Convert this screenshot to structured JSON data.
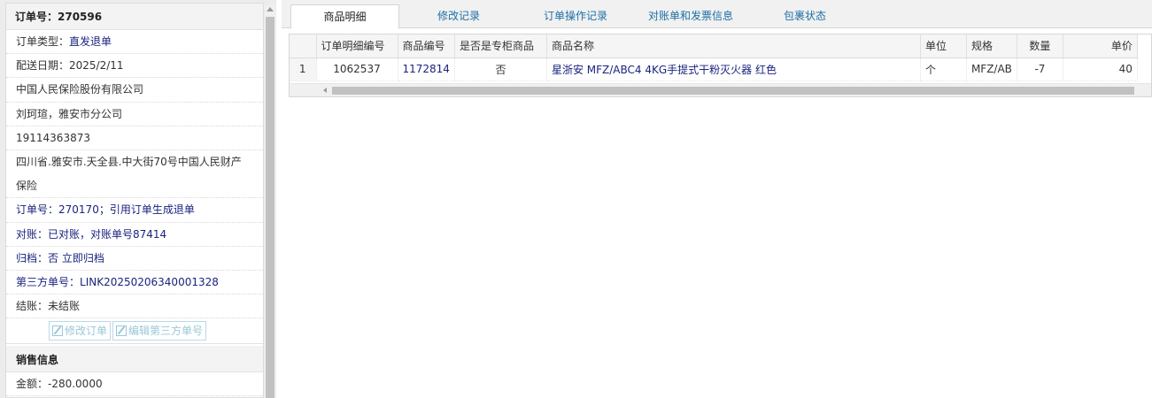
{
  "order_panel": {
    "header": "订单号：270596",
    "type_label": "订单类型：",
    "type_value": "直发退单",
    "delivery_date": "配送日期：2025/2/11",
    "company": "中国人民保险股份有限公司",
    "contact": "刘珂瑄，雅安市分公司",
    "phone": "19114363873",
    "address": "四川省.雅安市.天全县.中大街70号中国人民财产保险",
    "ref_order_label": "订单号：",
    "ref_order_value": "270170；引用订单生成退单",
    "reconcile_label": "对账：",
    "reconcile_value": "已对账，对账单号87414",
    "archive_label": "归档：",
    "archive_value": "否 立即归档",
    "third_party_label": "第三方单号：",
    "third_party_value": "LINK20250206340001328",
    "settle": "结账：未结账",
    "edit_order_button": "修改订单",
    "edit_third_party_button": "编辑第三方单号"
  },
  "sales_panel": {
    "header": "销售信息",
    "amount": "金额：-280.0000"
  },
  "tabs": [
    {
      "label": "商品明细",
      "active": true
    },
    {
      "label": "修改记录",
      "active": false
    },
    {
      "label": "订单操作记录",
      "active": false
    },
    {
      "label": "对账单和发票信息",
      "active": false
    },
    {
      "label": "包裹状态",
      "active": false
    }
  ],
  "grid": {
    "columns": [
      "订单明细编号",
      "商品编号",
      "是否是专柜商品",
      "商品名称",
      "单位",
      "规格",
      "数量",
      "单价"
    ],
    "rows": [
      {
        "index": "1",
        "detail_id": "1062537",
        "product_id": "1172814",
        "is_counter": "否",
        "name": "星浙安 MFZ/ABC4 4KG手提式干粉灭火器 红色",
        "unit": "个",
        "spec": "MFZ/AB",
        "qty": "-7",
        "price": "40"
      }
    ]
  }
}
